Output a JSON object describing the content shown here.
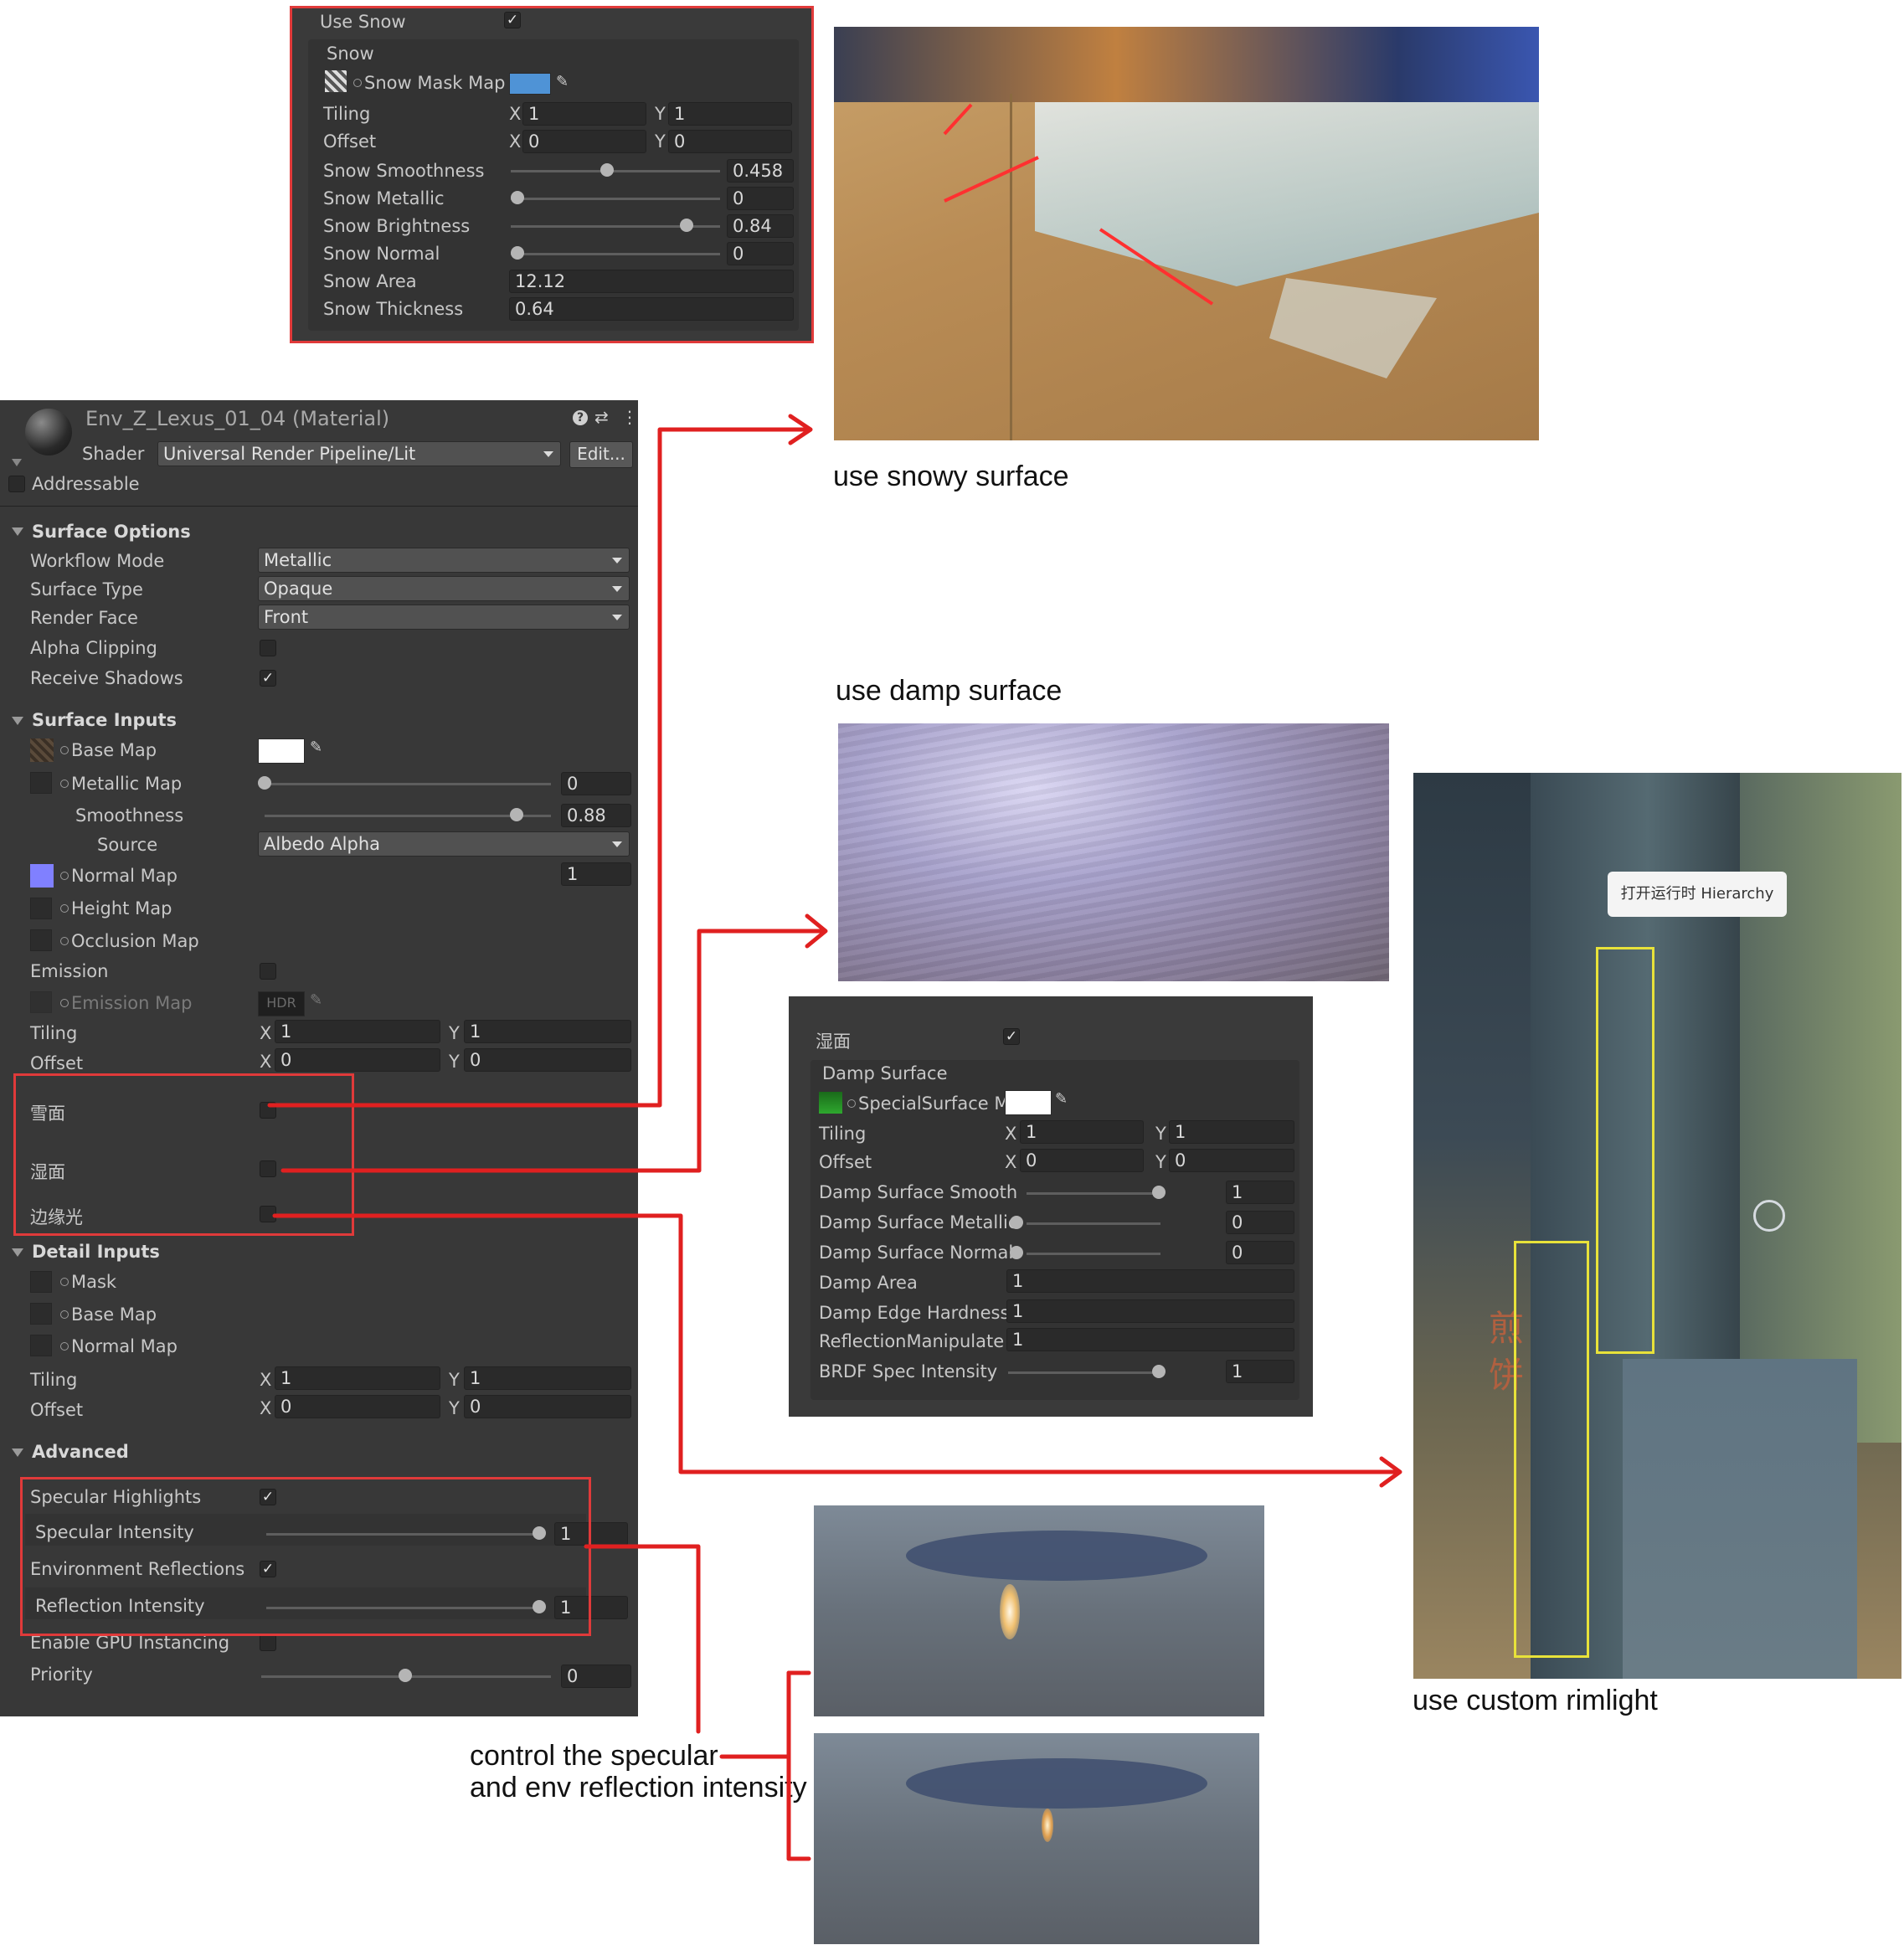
{
  "snow_panel": {
    "use_label": "Use Snow",
    "group_label": "Snow",
    "mask_map_label": "Snow Mask Map",
    "tiling_label": "Tiling",
    "tiling_x": "1",
    "tiling_y": "1",
    "offset_label": "Offset",
    "offset_x": "0",
    "offset_y": "0",
    "smoothness_label": "Snow Smoothness",
    "smoothness_value": "0.458",
    "smoothness_level": 0.458,
    "metallic_label": "Snow Metallic",
    "metallic_value": "0",
    "brightness_label": "Snow Brightness",
    "brightness_value": "0.84",
    "brightness_level": 0.84,
    "normal_label": "Snow Normal",
    "normal_value": "0",
    "area_label": "Snow Area",
    "area_value": "12.12",
    "thickness_label": "Snow Thickness",
    "thickness_value": "0.64"
  },
  "inspector": {
    "title": "Env_Z_Lexus_01_04 (Material)",
    "shader_label": "Shader",
    "shader_value": "Universal Render Pipeline/Lit",
    "edit_button": "Edit...",
    "addressable_label": "Addressable",
    "surface_options": {
      "header": "Surface Options",
      "workflow_label": "Workflow Mode",
      "workflow_value": "Metallic",
      "surface_type_label": "Surface Type",
      "surface_type_value": "Opaque",
      "render_face_label": "Render Face",
      "render_face_value": "Front",
      "alpha_clipping_label": "Alpha Clipping",
      "receive_shadows_label": "Receive Shadows"
    },
    "surface_inputs": {
      "header": "Surface Inputs",
      "base_map_label": "Base Map",
      "metallic_map_label": "Metallic Map",
      "metallic_value": "0",
      "smoothness_label": "Smoothness",
      "smoothness_value": "0.88",
      "smoothness_level": 0.88,
      "source_label": "Source",
      "source_value": "Albedo Alpha",
      "normal_map_label": "Normal Map",
      "normal_value": "1",
      "height_map_label": "Height Map",
      "occlusion_map_label": "Occlusion Map",
      "emission_label": "Emission",
      "emission_map_label": "Emission Map",
      "hdr_label": "HDR",
      "tiling_label": "Tiling",
      "tiling_x": "1",
      "tiling_y": "1",
      "offset_label": "Offset",
      "offset_x": "0",
      "offset_y": "0",
      "snow_toggle_label": "雪面",
      "damp_toggle_label": "湿面",
      "rim_toggle_label": "边缘光"
    },
    "detail_inputs": {
      "header": "Detail Inputs",
      "mask_label": "Mask",
      "base_map_label": "Base Map",
      "normal_map_label": "Normal Map",
      "tiling_label": "Tiling",
      "tiling_x": "1",
      "tiling_y": "1",
      "offset_label": "Offset",
      "offset_x": "0",
      "offset_y": "0"
    },
    "advanced": {
      "header": "Advanced",
      "specular_highlights_label": "Specular Highlights",
      "specular_intensity_label": "Specular Intensity",
      "specular_intensity_value": "1",
      "env_reflections_label": "Environment Reflections",
      "reflection_intensity_label": "Reflection Intensity",
      "reflection_intensity_value": "1",
      "gpu_instancing_label": "Enable GPU Instancing",
      "priority_label": "Priority",
      "priority_value": "0"
    }
  },
  "damp_panel": {
    "toggle_label": "湿面",
    "group_label": "Damp Surface",
    "special_map_label": "SpecialSurface M",
    "tiling_label": "Tiling",
    "tiling_x": "1",
    "tiling_y": "1",
    "offset_label": "Offset",
    "offset_x": "0",
    "offset_y": "0",
    "smooth_label": "Damp Surface Smooth",
    "smooth_value": "1",
    "metallic_label": "Damp Surface Metallic",
    "metallic_value": "0",
    "normal_label": "Damp Surface Normal",
    "normal_value": "0",
    "area_label": "Damp Area",
    "area_value": "1",
    "edge_label": "Damp Edge Hardness",
    "edge_value": "1",
    "reflection_label": "ReflectionManipulate \\",
    "reflection_value": "1",
    "brdf_label": "BRDF Spec Intensity",
    "brdf_value": "1"
  },
  "captions": {
    "snowy": "use snowy surface",
    "damp": "use damp surface",
    "rim": "use custom rimlight",
    "spec_line1": "control the specular",
    "spec_line2": "and env reflection intensity"
  },
  "rim_screenshot": {
    "tooltip": "打开运行时 Hierarchy",
    "sign_text_1": "煎",
    "sign_text_2": "饼"
  },
  "colors": {
    "panel_bg": "#383838",
    "annotation_red": "#e03a3a",
    "highlight_yellow": "#e8e23a"
  }
}
